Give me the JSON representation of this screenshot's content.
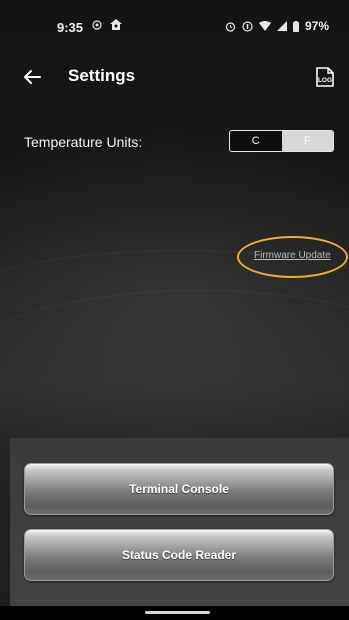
{
  "status_bar": {
    "time": "9:35",
    "battery": "97%",
    "icons_left": [
      "notification-icon",
      "home-app-icon"
    ],
    "icons_right": [
      "alarm-icon",
      "data-saver-icon",
      "wifi-icon",
      "signal-icon",
      "battery-icon"
    ]
  },
  "app_bar": {
    "title": "Settings",
    "back_icon": "back-arrow-icon",
    "log_icon": "log-icon"
  },
  "settings": {
    "temperature_label": "Temperature Units:",
    "unit_options": [
      "C",
      "F"
    ],
    "selected_unit": "F",
    "firmware_link": "Firmware Update",
    "highlight_color": "#e6b32b"
  },
  "buttons": {
    "terminal_console": "Terminal Console",
    "status_code_reader": "Status Code Reader"
  }
}
